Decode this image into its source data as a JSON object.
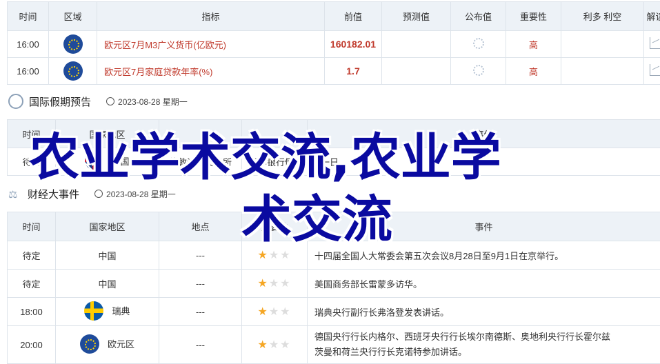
{
  "calendar": {
    "headers": [
      "时间",
      "区域",
      "指标",
      "前值",
      "预测值",
      "公布值",
      "重要性",
      "利多 利空",
      "解读"
    ],
    "rows": [
      {
        "time": "16:00",
        "region_icon": "eu-flag-icon",
        "indicator": "欧元区7月M3广义货币(亿欧元)",
        "previous": "160182.01",
        "forecast": "",
        "actual_icon": "loading-icon",
        "importance": "高",
        "impact": "",
        "detail_icon": "chart-icon"
      },
      {
        "time": "16:00",
        "region_icon": "eu-flag-icon",
        "indicator": "欧元区7月家庭贷款年率(%)",
        "previous": "1.7",
        "forecast": "",
        "actual_icon": "loading-icon",
        "importance": "高",
        "impact": "",
        "detail_icon": "chart-icon"
      }
    ]
  },
  "holiday": {
    "title": "国际假期预告",
    "date": "2023-08-28 星期一",
    "headers": [
      "时间",
      "国家地区",
      "",
      "",
      "事件"
    ],
    "rows": [
      {
        "time": "待定",
        "country": "英国",
        "place": "伦敦证券交易所",
        "event": "夏季银行假日休市一日"
      }
    ]
  },
  "events": {
    "title": "财经大事件",
    "date": "2023-08-28 星期一",
    "headers": [
      "时间",
      "国家地区",
      "地点",
      "重要性",
      "事件"
    ],
    "rows": [
      {
        "time": "待定",
        "country": "中国",
        "flag": "",
        "place": "---",
        "stars": 1,
        "event": "十四届全国人大常委会第五次会议8月28日至9月1日在京举行。"
      },
      {
        "time": "待定",
        "country": "中国",
        "flag": "",
        "place": "---",
        "stars": 1,
        "event": "美国商务部长雷蒙多访华。"
      },
      {
        "time": "18:00",
        "country": "瑞典",
        "flag": "se",
        "place": "---",
        "stars": 1,
        "event": "瑞典央行副行长弗洛登发表讲话。"
      },
      {
        "time": "20:00",
        "country": "欧元区",
        "flag": "eu",
        "place": "---",
        "stars": 1,
        "event_line1": "德国央行行长内格尔、西班牙央行行长埃尔南德斯、奥地利央行行长霍尔兹",
        "event_line2": "茨曼和荷兰央行行长克诺特参加讲话。"
      }
    ]
  },
  "overlay": {
    "line1": "农业学术交流,农业学",
    "line2": "术交流"
  },
  "colors": {
    "accent_red": "#c0392b",
    "header_bg": "#edf2f7",
    "overlay_blue": "#0a0aa0",
    "star": "#f5a623"
  }
}
